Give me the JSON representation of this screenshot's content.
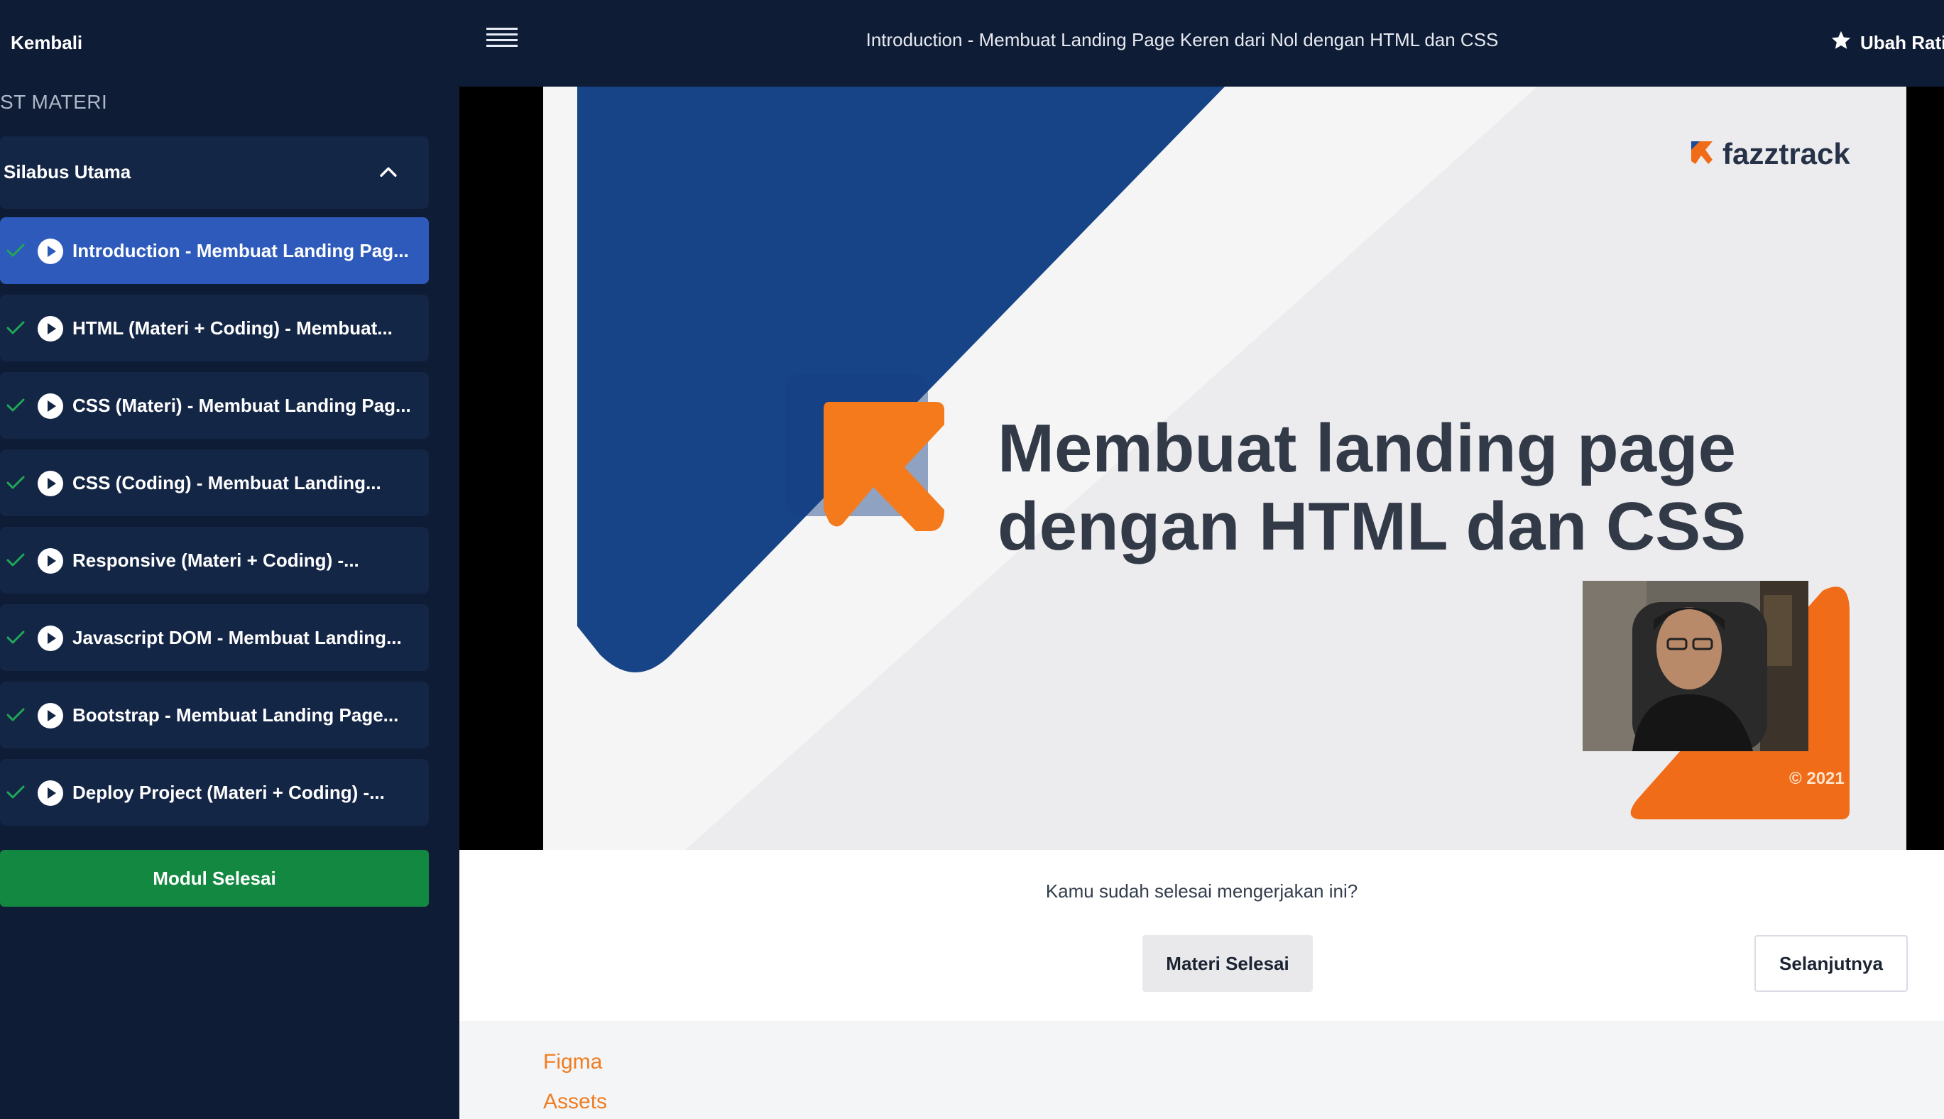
{
  "header": {
    "back_label": "Kembali",
    "menu_icon": "hamburger-menu-icon",
    "title": "Introduction - Membuat Landing Page Keren dari Nol dengan HTML dan CSS",
    "rating_label": "Ubah Rati",
    "rating_icon": "star-icon"
  },
  "sidebar": {
    "section_title": "ST MATERI",
    "syllabus_label": "Silabus Utama",
    "lessons": [
      {
        "label": "Introduction - Membuat Landing Pag...",
        "completed": true,
        "active": true
      },
      {
        "label": "HTML (Materi + Coding) - Membuat...",
        "completed": true,
        "active": false
      },
      {
        "label": "CSS (Materi) - Membuat Landing Pag...",
        "completed": true,
        "active": false
      },
      {
        "label": "CSS (Coding) - Membuat Landing...",
        "completed": true,
        "active": false
      },
      {
        "label": "Responsive (Materi + Coding) -...",
        "completed": true,
        "active": false
      },
      {
        "label": "Javascript DOM - Membuat Landing...",
        "completed": true,
        "active": false
      },
      {
        "label": "Bootstrap - Membuat Landing Page...",
        "completed": true,
        "active": false
      },
      {
        "label": "Deploy Project (Materi + Coding) -...",
        "completed": true,
        "active": false
      }
    ],
    "module_done_label": "Modul Selesai"
  },
  "video": {
    "brand": "fazztrack",
    "heading_line1": "Membuat landing page",
    "heading_line2": "dengan HTML dan CSS",
    "year": "© 2021"
  },
  "completion": {
    "question": "Kamu sudah selesai mengerjakan ini?",
    "done_label": "Materi Selesai",
    "next_label": "Selanjutnya"
  },
  "resources": {
    "links": [
      "Figma",
      "Assets"
    ]
  },
  "colors": {
    "sidebar_bg": "#0e1c36",
    "active_item": "#2e5bbb",
    "success": "#128841",
    "link": "#ef7d22"
  }
}
